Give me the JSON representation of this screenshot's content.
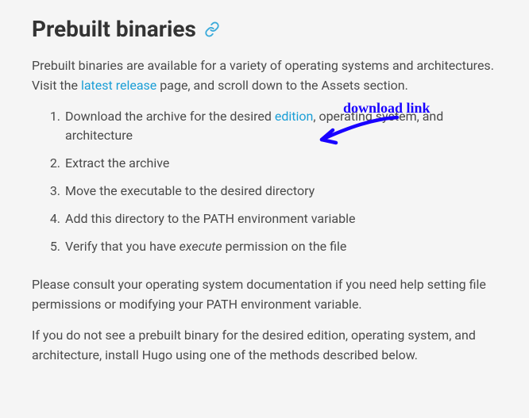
{
  "heading": "Prebuilt binaries",
  "intro": {
    "prefix": "Prebuilt binaries are available for a variety of operating systems and architectures. Visit the ",
    "link_text": "latest release",
    "suffix": " page, and scroll down to the Assets section."
  },
  "steps": {
    "s1_prefix": "Download the archive for the desired ",
    "s1_link": "edition",
    "s1_suffix": ", operating system, and architecture",
    "s2": "Extract the archive",
    "s3": "Move the executable to the desired directory",
    "s4": "Add this directory to the PATH environment variable",
    "s5_prefix": "Verify that you have ",
    "s5_em": "execute",
    "s5_suffix": " permission on the file"
  },
  "para2": "Please consult your operating system documentation if you need help setting file permissions or modifying your PATH environment variable.",
  "para3": "If you do not see a prebuilt binary for the desired edition, operating system, and architecture, install Hugo using one of the methods described below.",
  "annotation": {
    "label": "download link"
  },
  "colors": {
    "link": "#1a9ed6",
    "annotation": "#1800ff"
  }
}
